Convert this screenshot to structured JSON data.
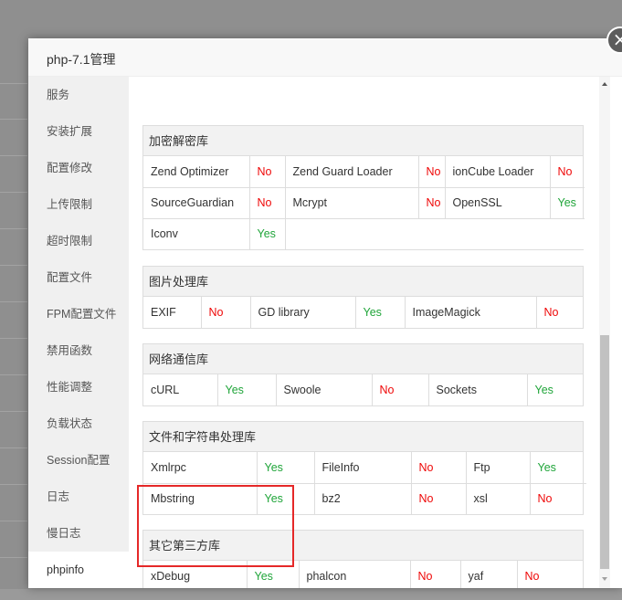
{
  "modal": {
    "title": "php-7.1管理",
    "close_label": "×"
  },
  "sidebar": {
    "items": [
      {
        "label": "服务"
      },
      {
        "label": "安装扩展"
      },
      {
        "label": "配置修改"
      },
      {
        "label": "上传限制"
      },
      {
        "label": "超时限制"
      },
      {
        "label": "配置文件"
      },
      {
        "label": "FPM配置文件"
      },
      {
        "label": "禁用函数"
      },
      {
        "label": "性能调整"
      },
      {
        "label": "负载状态"
      },
      {
        "label": "Session配置"
      },
      {
        "label": "日志"
      },
      {
        "label": "慢日志"
      },
      {
        "label": "phpinfo"
      }
    ],
    "active": "phpinfo"
  },
  "sections": {
    "crypto": {
      "title": "加密解密库",
      "rows": [
        [
          {
            "name": "Zend Optimizer",
            "status": "No"
          },
          {
            "name": "Zend Guard Loader",
            "status": "No"
          },
          {
            "name": "ionCube Loader",
            "status": "No"
          }
        ],
        [
          {
            "name": "SourceGuardian",
            "status": "No"
          },
          {
            "name": "Mcrypt",
            "status": "No"
          },
          {
            "name": "OpenSSL",
            "status": "Yes"
          }
        ],
        [
          {
            "name": "Iconv",
            "status": "Yes"
          }
        ]
      ]
    },
    "image": {
      "title": "图片处理库",
      "rows": [
        [
          {
            "name": "EXIF",
            "status": "No"
          },
          {
            "name": "GD library",
            "status": "Yes"
          },
          {
            "name": "ImageMagick",
            "status": "No"
          }
        ]
      ]
    },
    "network": {
      "title": "网络通信库",
      "rows": [
        [
          {
            "name": "cURL",
            "status": "Yes"
          },
          {
            "name": "Swoole",
            "status": "No"
          },
          {
            "name": "Sockets",
            "status": "Yes"
          }
        ]
      ]
    },
    "string": {
      "title": "文件和字符串处理库",
      "rows": [
        [
          {
            "name": "Xmlrpc",
            "status": "Yes"
          },
          {
            "name": "FileInfo",
            "status": "No"
          },
          {
            "name": "Ftp",
            "status": "Yes"
          }
        ],
        [
          {
            "name": "Mbstring",
            "status": "Yes"
          },
          {
            "name": "bz2",
            "status": "No"
          },
          {
            "name": "xsl",
            "status": "No"
          }
        ]
      ]
    },
    "thirdparty": {
      "title": "其它第三方库",
      "rows": [
        [
          {
            "name": "xDebug",
            "status": "Yes"
          },
          {
            "name": "phalcon",
            "status": "No"
          },
          {
            "name": "yaf",
            "status": "No"
          }
        ]
      ]
    }
  },
  "colors": {
    "yes": "#20a53a",
    "no": "#ef0808",
    "highlight_border": "#e52828"
  }
}
